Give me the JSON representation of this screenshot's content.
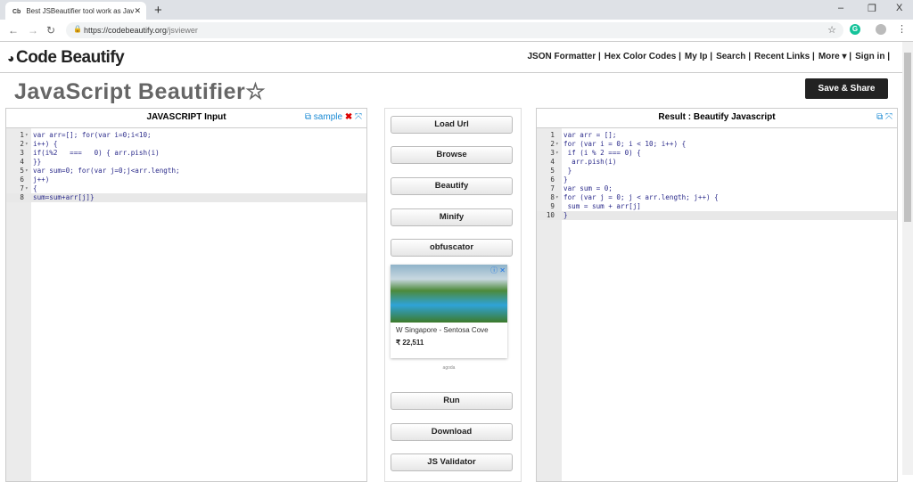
{
  "browser": {
    "tab_title": "Best JSBeautifier tool work as Jav",
    "tab_favicon": "Cb",
    "url_host": "https://codebeautify.org",
    "url_path": "/jsviewer",
    "window": {
      "minimize": "–",
      "maximize": "❐",
      "close": "X"
    }
  },
  "site": {
    "logo": "Code Beautify",
    "nav": [
      "JSON Formatter |",
      "Hex Color Codes |",
      "My Ip |",
      "Search |",
      "Recent Links |",
      "More ▾ |",
      "Sign in |"
    ],
    "page_title": "JavaScript Beautifier☆",
    "save_share": "Save & Share"
  },
  "input_panel": {
    "title": "JAVASCRIPT Input",
    "sample": "sample",
    "lines": [
      {
        "n": "1",
        "fold": true,
        "code": "var arr=[]; for(var i=0;i<10;"
      },
      {
        "n": "2",
        "fold": true,
        "code": "i++) {"
      },
      {
        "n": "3",
        "fold": false,
        "code": "if(i%2   ===   0) { arr.pish(i)"
      },
      {
        "n": "4",
        "fold": false,
        "code": "}}"
      },
      {
        "n": "5",
        "fold": true,
        "code": "var sum=0; for(var j=0;j<arr.length;"
      },
      {
        "n": "6",
        "fold": false,
        "code": "j++)"
      },
      {
        "n": "7",
        "fold": true,
        "code": "{"
      },
      {
        "n": "8",
        "fold": false,
        "code": "sum=sum+arr[j]}",
        "active": true
      }
    ]
  },
  "output_panel": {
    "title": "Result : Beautify Javascript",
    "lines": [
      {
        "n": "1",
        "fold": false,
        "code": "var arr = [];"
      },
      {
        "n": "2",
        "fold": true,
        "code": "for (var i = 0; i < 10; i++) {"
      },
      {
        "n": "3",
        "fold": true,
        "code": " if (i % 2 === 0) {"
      },
      {
        "n": "4",
        "fold": false,
        "code": "  arr.pish(i)"
      },
      {
        "n": "5",
        "fold": false,
        "code": " }"
      },
      {
        "n": "6",
        "fold": false,
        "code": "}"
      },
      {
        "n": "7",
        "fold": false,
        "code": "var sum = 0;"
      },
      {
        "n": "8",
        "fold": true,
        "code": "for (var j = 0; j < arr.length; j++) {"
      },
      {
        "n": "9",
        "fold": false,
        "code": " sum = sum + arr[j]"
      },
      {
        "n": "10",
        "fold": false,
        "code": "}",
        "active": true
      }
    ]
  },
  "buttons": {
    "load_url": "Load Url",
    "browse": "Browse",
    "beautify": "Beautify",
    "minify": "Minify",
    "obfuscator": "obfuscator",
    "run": "Run",
    "download": "Download",
    "validator": "JS Validator"
  },
  "ad": {
    "title": "W Singapore - Sentosa Cove",
    "price": "₹ 22,511",
    "brand": "agoda"
  }
}
